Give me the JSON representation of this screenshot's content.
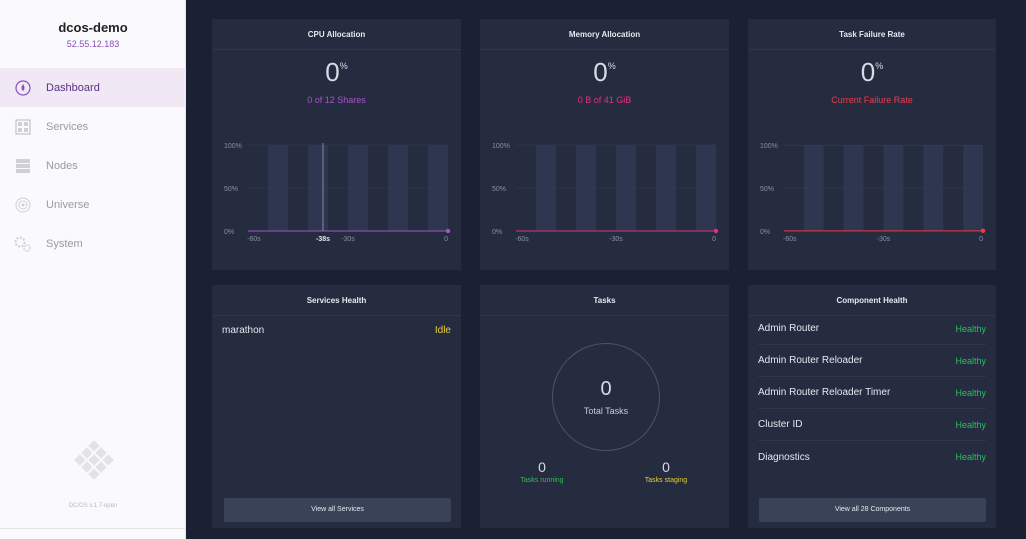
{
  "cluster": {
    "name": "dcos-demo",
    "ip": "52.55.12.183"
  },
  "nav": [
    {
      "label": "Dashboard",
      "icon": "dashboard-icon"
    },
    {
      "label": "Services",
      "icon": "services-icon"
    },
    {
      "label": "Nodes",
      "icon": "nodes-icon"
    },
    {
      "label": "Universe",
      "icon": "universe-icon"
    },
    {
      "label": "System",
      "icon": "system-icon"
    }
  ],
  "version": "DC/OS v.1.7-open",
  "colors": {
    "purple": "#a455c8",
    "pink": "#e5307b",
    "red": "#ef3a4c",
    "green": "#2fbf5a",
    "yellow": "#e8cc3a"
  },
  "cpu": {
    "title": "CPU Allocation",
    "value": "0",
    "unit": "%",
    "subtitle": "0 of 12 Shares",
    "chart_data": {
      "type": "bar",
      "y_ticks": [
        "100%",
        "50%",
        "0%"
      ],
      "x_ticks": [
        "-60s",
        "-38s",
        "-30s",
        "0"
      ],
      "cursor": "-38s",
      "ylim": [
        0,
        100
      ],
      "values": [
        0,
        0,
        0,
        0,
        0,
        0,
        0,
        0,
        0,
        0
      ]
    }
  },
  "memory": {
    "title": "Memory Allocation",
    "value": "0",
    "unit": "%",
    "subtitle": "0 B of 41 GiB",
    "chart_data": {
      "type": "bar",
      "y_ticks": [
        "100%",
        "50%",
        "0%"
      ],
      "x_ticks": [
        "-60s",
        "-30s",
        "0"
      ],
      "ylim": [
        0,
        100
      ],
      "values": [
        0,
        0,
        0,
        0,
        0,
        0,
        0,
        0,
        0,
        0
      ]
    }
  },
  "failure": {
    "title": "Task Failure Rate",
    "value": "0",
    "unit": "%",
    "subtitle": "Current Failure Rate",
    "chart_data": {
      "type": "bar",
      "y_ticks": [
        "100%",
        "50%",
        "0%"
      ],
      "x_ticks": [
        "-60s",
        "-30s",
        "0"
      ],
      "ylim": [
        0,
        100
      ],
      "values": [
        0,
        0,
        0,
        0,
        0,
        0,
        0,
        0,
        0,
        0
      ]
    }
  },
  "services_health": {
    "title": "Services Health",
    "items": [
      {
        "name": "marathon",
        "status": "Idle"
      }
    ],
    "button": "View all Services"
  },
  "tasks": {
    "title": "Tasks",
    "total": "0",
    "total_label": "Total Tasks",
    "running": "0",
    "running_label": "Tasks running",
    "staging": "0",
    "staging_label": "Tasks staging"
  },
  "component_health": {
    "title": "Component Health",
    "items": [
      {
        "name": "Admin Router",
        "status": "Healthy"
      },
      {
        "name": "Admin Router Reloader",
        "status": "Healthy"
      },
      {
        "name": "Admin Router Reloader Timer",
        "status": "Healthy"
      },
      {
        "name": "Cluster ID",
        "status": "Healthy"
      },
      {
        "name": "Diagnostics",
        "status": "Healthy"
      }
    ],
    "button": "View all 28 Components"
  }
}
